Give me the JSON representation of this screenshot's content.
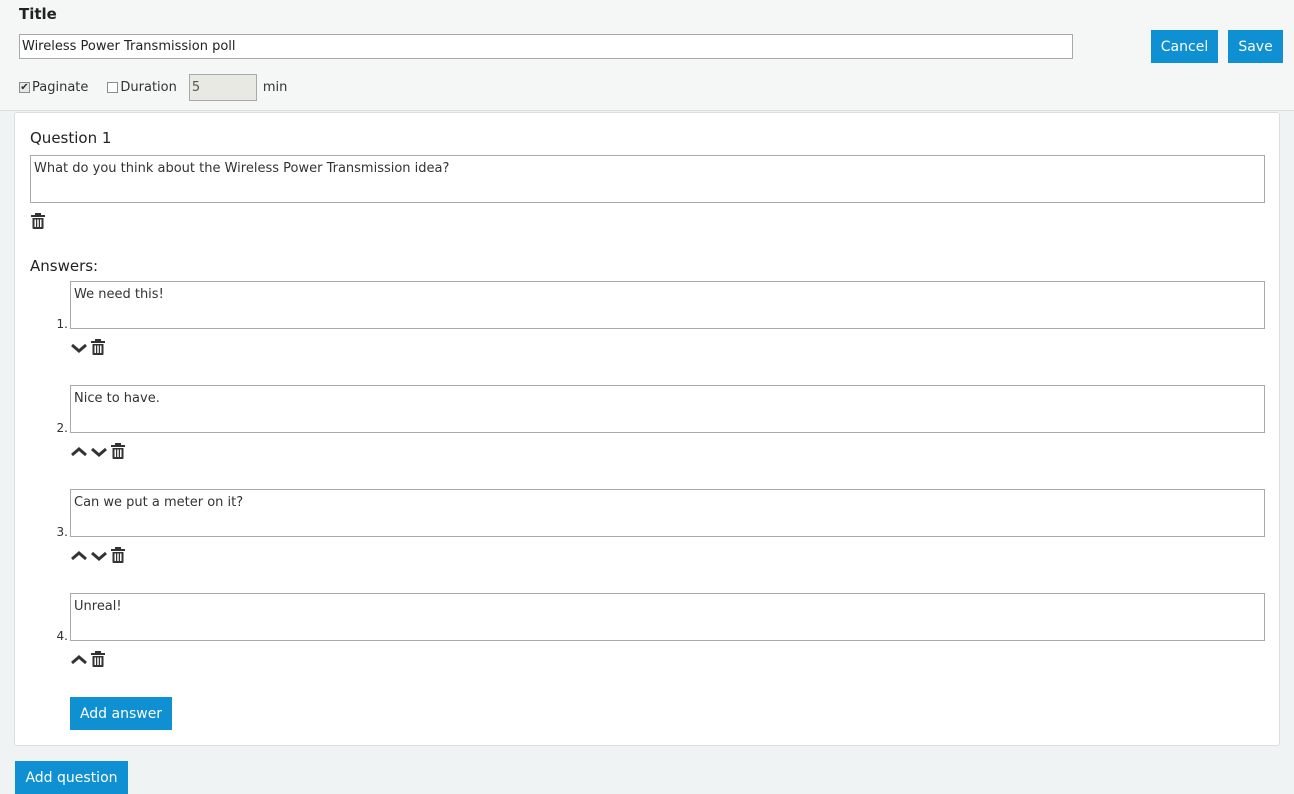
{
  "header": {
    "title_label": "Title",
    "title_value": "Wireless Power Transmission poll",
    "cancel_label": "Cancel",
    "save_label": "Save",
    "paginate_label": "Paginate",
    "paginate_checked": true,
    "duration_label": "Duration",
    "duration_checked": false,
    "duration_value": "5",
    "duration_unit": "min"
  },
  "question": {
    "title": "Question 1",
    "text": "What do you think about the Wireless Power Transmission idea?",
    "answers_label": "Answers:",
    "answers": [
      {
        "number": "1.",
        "text": "We need this!",
        "controls": [
          "move-down",
          "delete"
        ]
      },
      {
        "number": "2.",
        "text": "Nice to have.",
        "controls": [
          "move-up",
          "move-down",
          "delete"
        ]
      },
      {
        "number": "3.",
        "text": "Can we put a meter on it?",
        "controls": [
          "move-up",
          "move-down",
          "delete"
        ]
      },
      {
        "number": "4.",
        "text": "Unreal!",
        "controls": [
          "move-up",
          "delete"
        ]
      }
    ],
    "add_answer_label": "Add answer"
  },
  "add_question_label": "Add question",
  "colors": {
    "accent": "#0e90d2",
    "background": "#f0f3f4"
  },
  "icons": {
    "delete": "trash-icon",
    "move_up": "chevron-up-icon",
    "move_down": "chevron-down-icon"
  }
}
